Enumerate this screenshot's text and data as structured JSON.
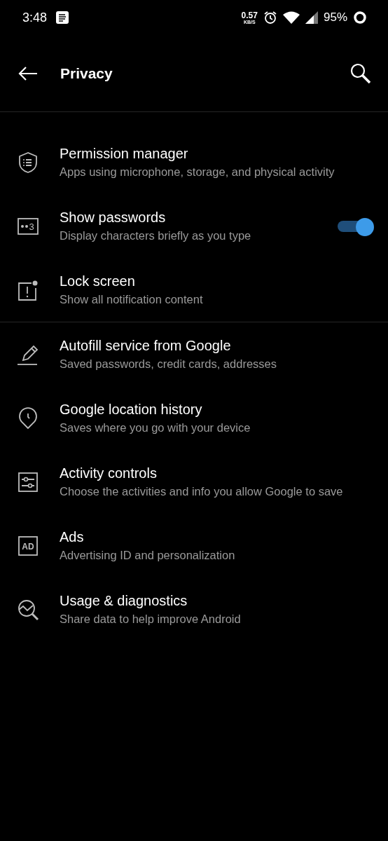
{
  "status_bar": {
    "time": "3:48",
    "speed": "0.57",
    "speed_unit": "KB/S",
    "battery": "95%"
  },
  "app_bar": {
    "title": "Privacy"
  },
  "sections": [
    {
      "items": [
        {
          "kind": "link",
          "title": "Permission manager",
          "subtitle": "Apps using microphone, storage, and physical activity"
        },
        {
          "kind": "switch",
          "icon_label": "3",
          "title": "Show passwords",
          "subtitle": "Display characters briefly as you type",
          "on": true
        },
        {
          "kind": "link",
          "title": "Lock screen",
          "subtitle": "Show all notification content"
        }
      ]
    },
    {
      "items": [
        {
          "kind": "link",
          "title": "Autofill service from Google",
          "subtitle": "Saved passwords, credit cards, addresses"
        },
        {
          "kind": "link",
          "title": "Google location history",
          "subtitle": "Saves where you go with your device"
        },
        {
          "kind": "link",
          "title": "Activity controls",
          "subtitle": "Choose the activities and info you allow Google to save"
        },
        {
          "kind": "link",
          "icon_label": "AD",
          "title": "Ads",
          "subtitle": "Advertising ID and personalization"
        },
        {
          "kind": "link",
          "title": "Usage & diagnostics",
          "subtitle": "Share data to help improve Android"
        }
      ]
    }
  ]
}
